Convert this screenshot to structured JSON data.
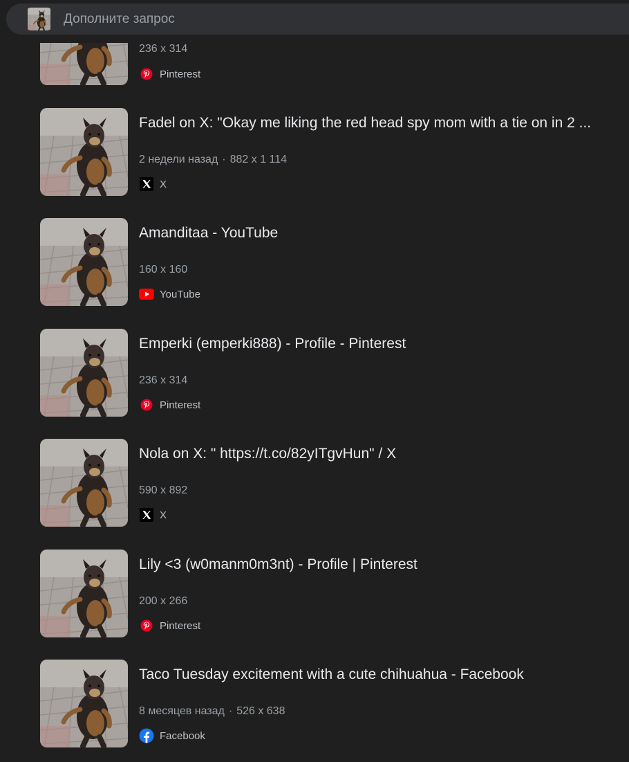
{
  "search": {
    "placeholder": "Дополните запрос"
  },
  "colors": {
    "background": "#1f1f1f",
    "searchbox": "#303134",
    "pinterest": "#e60023",
    "youtube": "#ff0000",
    "facebook": "#1877f2"
  },
  "results": [
    {
      "title": "",
      "time": "",
      "size": "236 x 314",
      "source": "Pinterest",
      "source_icon": "pinterest-icon"
    },
    {
      "title": "Fadel on X: \"Okay me liking the red head spy mom with a tie on in 2 ...",
      "time": "2 недели назад",
      "size": "882 x 1 114",
      "source": "X",
      "source_icon": "x-icon"
    },
    {
      "title": "Amanditaa - YouTube",
      "time": "",
      "size": "160 x 160",
      "source": "YouTube",
      "source_icon": "youtube-icon"
    },
    {
      "title": "Emperki (emperki888) - Profile - Pinterest",
      "time": "",
      "size": "236 x 314",
      "source": "Pinterest",
      "source_icon": "pinterest-icon"
    },
    {
      "title": "Nola on X: \" https://t.co/82yITgvHun\" / X",
      "time": "",
      "size": "590 x 892",
      "source": "X",
      "source_icon": "x-icon"
    },
    {
      "title": "Lily <3 (w0manm0m3nt) - Profile | Pinterest",
      "time": "",
      "size": "200 x 266",
      "source": "Pinterest",
      "source_icon": "pinterest-icon"
    },
    {
      "title": "Taco Tuesday excitement with a cute chihuahua - Facebook",
      "time": "8 месяцев назад",
      "size": "526 x 638",
      "source": "Facebook",
      "source_icon": "facebook-icon"
    }
  ]
}
